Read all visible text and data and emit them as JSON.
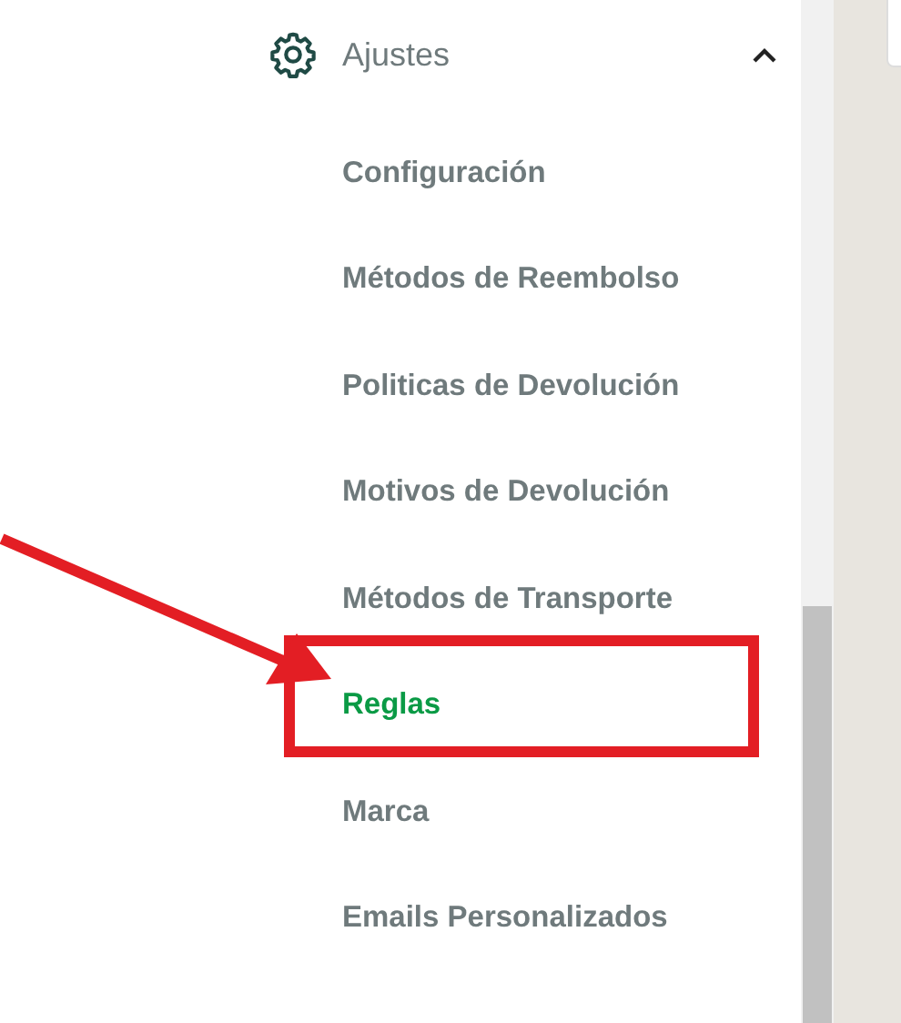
{
  "sidebar": {
    "section": {
      "label": "Ajustes",
      "expanded": true
    },
    "items": [
      {
        "label": "Configuración",
        "selected": false,
        "highlighted": false
      },
      {
        "label": "Métodos de Reembolso",
        "selected": false,
        "highlighted": false
      },
      {
        "label": "Politicas de Devolución",
        "selected": false,
        "highlighted": false
      },
      {
        "label": "Motivos de Devolución",
        "selected": false,
        "highlighted": false
      },
      {
        "label": "Métodos de Transporte",
        "selected": false,
        "highlighted": false
      },
      {
        "label": "Reglas",
        "selected": true,
        "highlighted": true
      },
      {
        "label": "Marca",
        "selected": false,
        "highlighted": false
      },
      {
        "label": "Emails Personalizados",
        "selected": false,
        "highlighted": false
      }
    ]
  }
}
